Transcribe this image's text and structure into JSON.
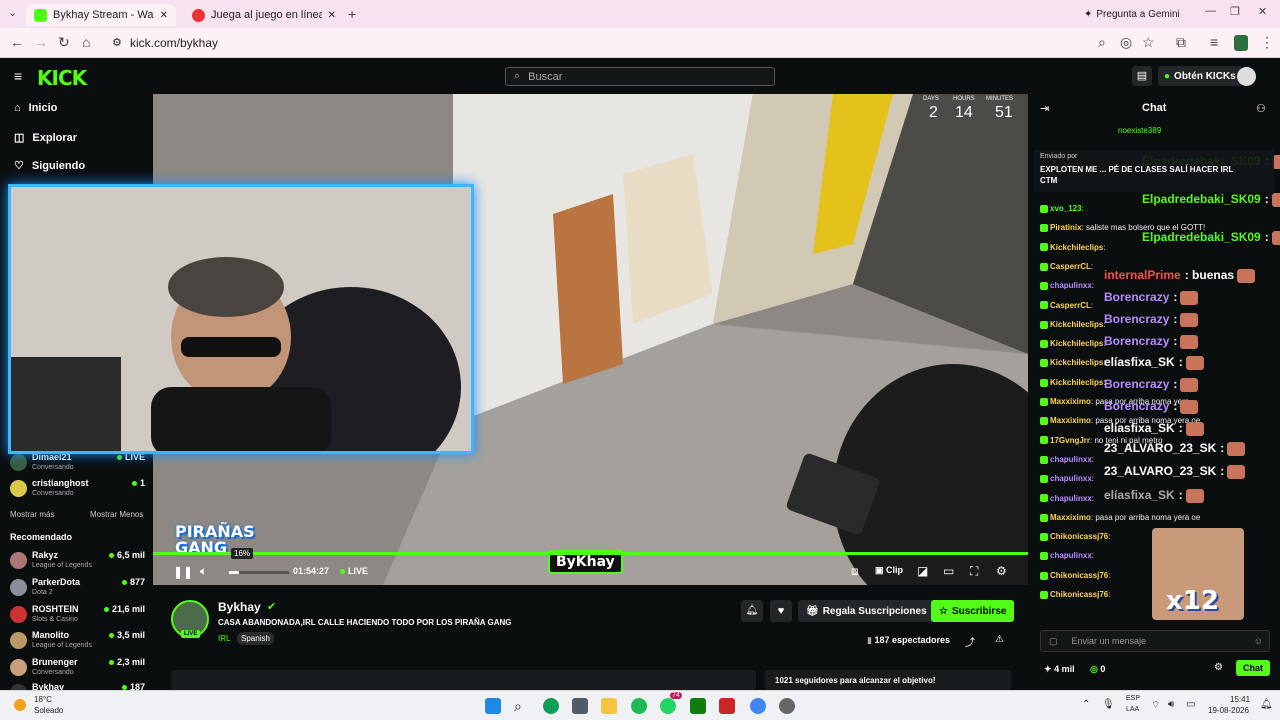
{
  "browser": {
    "tabs": [
      {
        "title": "Bykhay Stream - Watch Live"
      },
      {
        "title": "Juega al juego en línea Big Bas..."
      }
    ],
    "gemini_label": "Pregunta a Gemini",
    "url": "kick.com/bykhay"
  },
  "header": {
    "logo": "KICK",
    "search_placeholder": "Buscar",
    "get_kicks": "Obtén KICKs"
  },
  "sidebar": {
    "nav": [
      {
        "label": "Inicio",
        "icon": "home-icon"
      },
      {
        "label": "Explorar",
        "icon": "compass-icon"
      },
      {
        "label": "Siguiendo",
        "icon": "heart-icon"
      }
    ],
    "following": [
      {
        "name": "Dimael21",
        "category": "Conversando",
        "viewers": "LIVE"
      },
      {
        "name": "cristianghost",
        "category": "Conversando",
        "viewers": "1"
      }
    ],
    "show_more": "Mostrar más",
    "show_less": "Mostrar Menos",
    "recommended_title": "Recomendado",
    "recommended": [
      {
        "name": "Rakyz",
        "category": "League of Legends",
        "viewers": "6,5 mil"
      },
      {
        "name": "ParkerDota",
        "category": "Dota 2",
        "viewers": "877"
      },
      {
        "name": "ROSHTEIN",
        "category": "Slots & Casino",
        "viewers": "21,6 mil"
      },
      {
        "name": "Manolito",
        "category": "League of Legends",
        "viewers": "3,5 mil"
      },
      {
        "name": "Brunenger",
        "category": "Conversando",
        "viewers": "2,3 mil"
      },
      {
        "name": "Bykhay",
        "category": "",
        "viewers": "187"
      }
    ]
  },
  "video": {
    "countdown": {
      "days": "2",
      "hours": "14",
      "minutes": "51",
      "days_label": "DAYS",
      "hours_label": "HOURS",
      "minutes_label": "MINUTES"
    },
    "overlay_left": "PIRAÑAS GANG",
    "overlay_center": "ByKhay",
    "sponsor_label": "Enviado por",
    "sponsor_text": "EXPLOTEN ME ... PÉ DE CLASES SALÍ HACER IRL CTM",
    "volume_pct": "16%",
    "volume_level": 0.16,
    "elapsed": "01:54:27",
    "live_label": "LIVE",
    "clip_label": "Clip"
  },
  "streamer": {
    "name": "Bykhay",
    "title": "CASA ABANDONADA,IRL CALLE HACIENDO TODO POR LOS PIRAÑA GANG",
    "category": "IRL",
    "tag": "Spanish",
    "live_badge": "LIVE",
    "viewers": "187 espectadores",
    "gift_subs": "Regala Suscripciones",
    "subscribe": "Suscribirse",
    "goal_text": "1021 seguidores para alcanzar el objetivo!"
  },
  "chat": {
    "title": "Chat",
    "input_placeholder": "Enviar un mensaje",
    "kicks_count": "4 mil",
    "points": "0",
    "send_label": "Chat",
    "messages": [
      {
        "user": "xvo_123",
        "text": ""
      },
      {
        "user": "Piratinix",
        "text": "saliste mas bolsero que el GOTT!"
      },
      {
        "user": "Kickchileclips",
        "text": ""
      },
      {
        "user": "CasperrCL",
        "text": ""
      },
      {
        "user": "chapulinxx",
        "text": ""
      },
      {
        "user": "CasperrCL",
        "text": ""
      },
      {
        "user": "Kickchileclips",
        "text": ""
      },
      {
        "user": "Kickchileclips",
        "text": ""
      },
      {
        "user": "Kickchileclips",
        "text": ""
      },
      {
        "user": "Kickchileclips",
        "text": ""
      },
      {
        "user": "Maxxiximo",
        "text": "pasa por arriba noma yera"
      },
      {
        "user": "Maxxiximo",
        "text": "pasa por arriba noma yera oe"
      },
      {
        "user": "17GvngJrr",
        "text": "no teni ni pal metro"
      },
      {
        "user": "chapulinxx",
        "text": ""
      },
      {
        "user": "chapulinxx",
        "text": ""
      },
      {
        "user": "chapulinxx",
        "text": ""
      },
      {
        "user": "Maxxiximo",
        "text": "pasa por arriba noma yera oe"
      },
      {
        "user": "Chikonicassj76",
        "text": ""
      },
      {
        "user": "chapulinxx",
        "text": ""
      },
      {
        "user": "Chikonicassj76",
        "text": ""
      },
      {
        "user": "Chikonicassj76",
        "text": ""
      }
    ],
    "overlay_msgs": [
      {
        "user": "Elpadredebaki_SK09",
        "text": ":"
      },
      {
        "user": "Elpadredebaki_SK09",
        "text": ":"
      },
      {
        "user": "Elpadredebaki_SK09",
        "text": ":"
      },
      {
        "user": "internalPrime",
        "text": ": buenas"
      },
      {
        "user": "Borencrazy",
        "text": ":"
      },
      {
        "user": "Borencrazy",
        "text": ":"
      },
      {
        "user": "Borencrazy",
        "text": ":"
      },
      {
        "user": "elíasfixa_SK",
        "text": ":"
      },
      {
        "user": "Borencrazy",
        "text": ":"
      },
      {
        "user": "Borencrazy",
        "text": ":"
      },
      {
        "user": "elíasfixa_SK",
        "text": ":"
      },
      {
        "user": "23_ALVARO_23_SK",
        "text": ":"
      },
      {
        "user": "23_ALVARO_23_SK",
        "text": ":"
      },
      {
        "user": "elíasfixa_SK",
        "text": ":"
      }
    ],
    "top_user": "noexiste389",
    "multiplier": "x12"
  },
  "taskbar": {
    "temp": "18°C",
    "weather": "Soleado",
    "lang": "ESP",
    "region": "LAA",
    "time": "15:41",
    "date": "19-08-2026",
    "badge_count": "74"
  },
  "colors": {
    "kick_green": "#53fc18",
    "bg": "#0b0e0f",
    "cam_glow": "#3ab7ff"
  }
}
